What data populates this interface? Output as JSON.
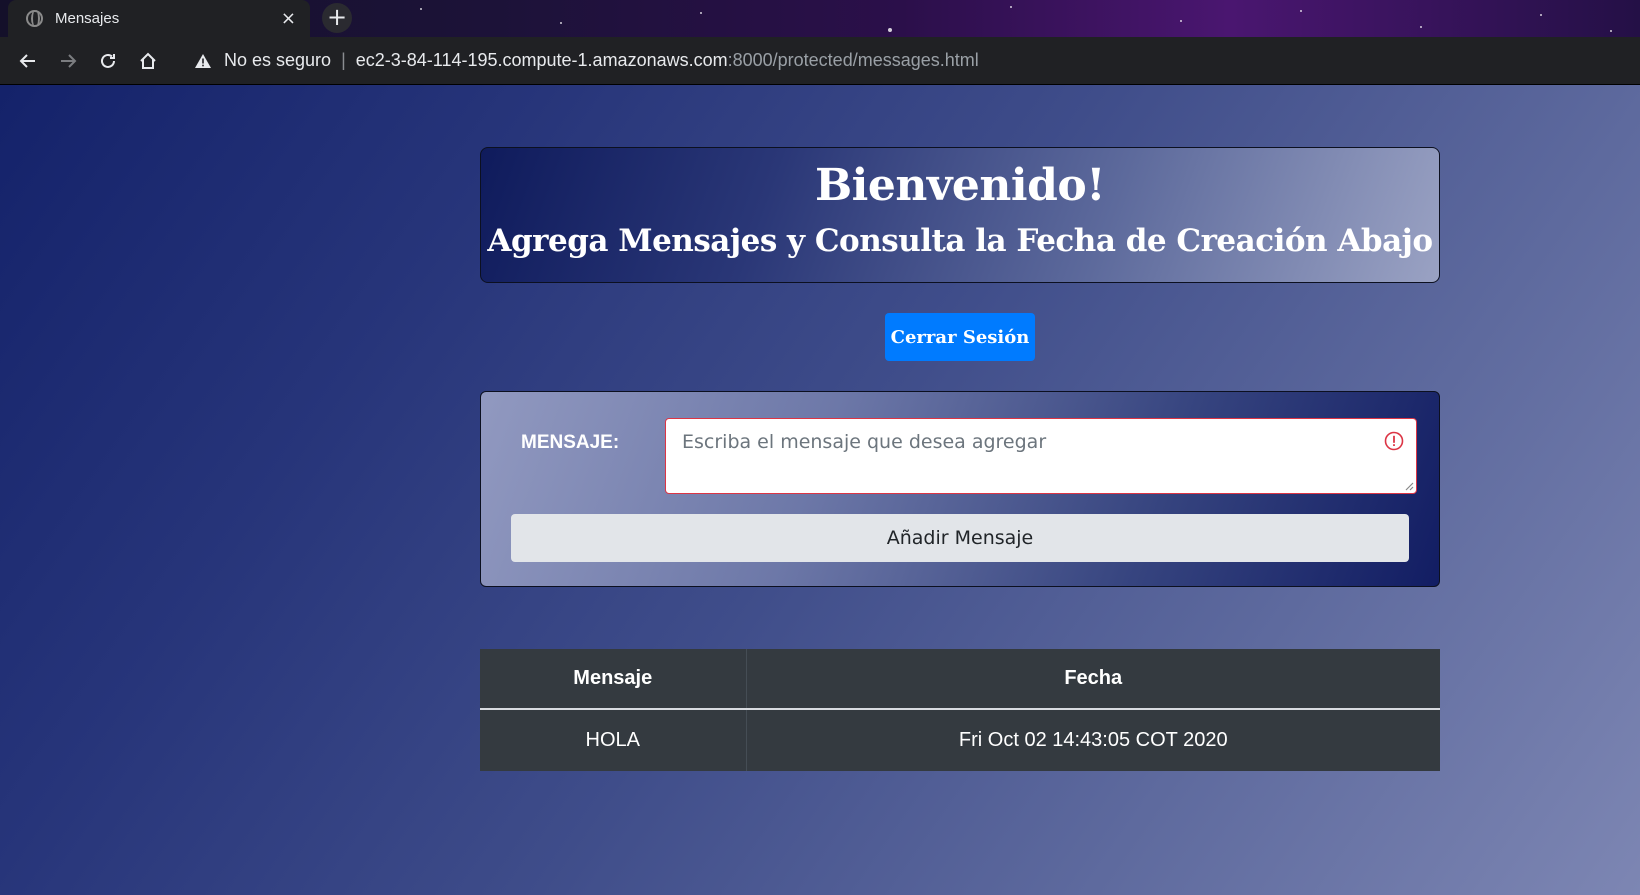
{
  "browser": {
    "tab_title": "Mensajes",
    "close_glyph": "×",
    "newtab_glyph": "+",
    "security_label": "No es seguro",
    "url_host": "ec2-3-84-114-195.compute-1.amazonaws.com",
    "url_rest": ":8000/protected/messages.html"
  },
  "header": {
    "title": "Bienvenido!",
    "subtitle": "Agrega Mensajes y Consulta la Fecha de Creación Abajo"
  },
  "logout_label": "Cerrar Sesión",
  "form": {
    "label": "MENSAJE:",
    "placeholder": "Escriba el mensaje que desea agregar",
    "submit_label": "Añadir Mensaje"
  },
  "table": {
    "columns": [
      "Mensaje",
      "Fecha"
    ],
    "rows": [
      {
        "message": "HOLA",
        "date": "Fri Oct 02 14:43:05 COT 2020"
      }
    ]
  },
  "colors": {
    "primary": "#007bff",
    "danger": "#dc3545",
    "table_bg": "#343a40"
  }
}
